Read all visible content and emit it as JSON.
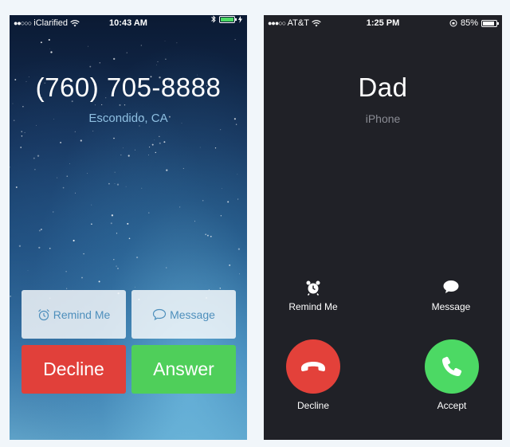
{
  "left_phone": {
    "status": {
      "carrier": "iClarified",
      "time": "10:43 AM",
      "battery_color": "#4cd964"
    },
    "caller": {
      "number": "(760) 705-8888",
      "location": "Escondido, CA"
    },
    "buttons": {
      "remind": "Remind Me",
      "message": "Message",
      "decline": "Decline",
      "answer": "Answer"
    }
  },
  "right_phone": {
    "status": {
      "carrier": "AT&T",
      "time": "1:25 PM",
      "battery_percent": "85%"
    },
    "caller": {
      "name": "Dad",
      "device": "iPhone"
    },
    "buttons": {
      "remind": "Remind Me",
      "message": "Message",
      "decline": "Decline",
      "accept": "Accept"
    }
  },
  "colors": {
    "decline": "#e1403a",
    "answer": "#4fcf5a",
    "dark_background": "#202127"
  }
}
